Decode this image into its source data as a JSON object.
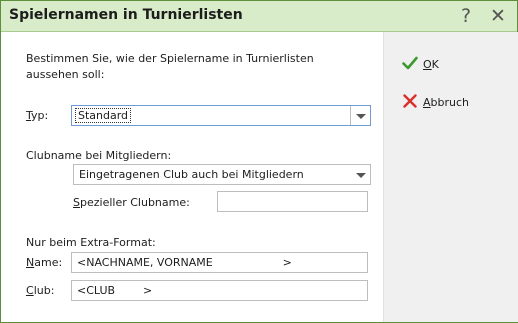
{
  "window": {
    "title": "Spielernamen in Turnierlisten",
    "help_glyph": "?",
    "close_glyph": "✕"
  },
  "form": {
    "intro_line1": "Bestimmen Sie, wie der Spielername in Turnierlisten",
    "intro_line2": "aussehen soll:",
    "typ": {
      "label_key": "T",
      "label_rest": "yp:",
      "value": "Standard"
    },
    "clubname": {
      "label": "Clubname bei Mitgliedern:",
      "value": "Eingetragenen Club auch bei Mitgliedern",
      "special_label_key": "S",
      "special_label_rest": "pezieller Clubname:",
      "special_value": ""
    },
    "extra": {
      "heading": "Nur beim Extra-Format:",
      "name_label_key": "N",
      "name_label_rest": "ame:",
      "name_value": "<NACHNAME, VORNAME                    >",
      "club_label_key": "C",
      "club_label_rest": "lub:",
      "club_value": "<CLUB        >"
    }
  },
  "actions": {
    "ok_key": "O",
    "ok_rest": "K",
    "cancel_key": "A",
    "cancel_rest": "bbruch"
  },
  "colors": {
    "title_bar": "#d9ecc9",
    "ok_icon": "#3a9a2c",
    "cancel_icon": "#d9302a"
  }
}
